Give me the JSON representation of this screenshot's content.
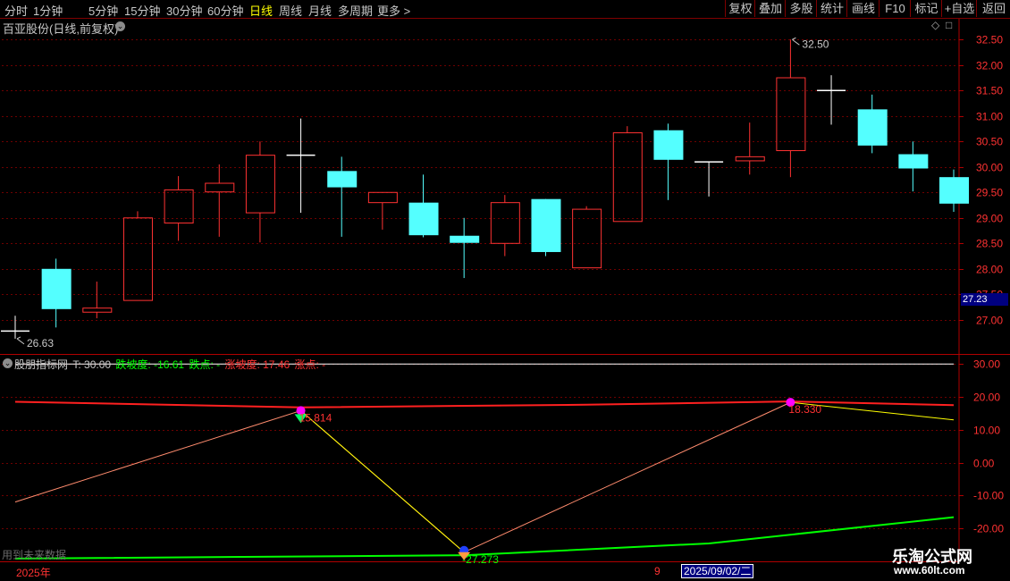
{
  "toolbar": {
    "periods": [
      "分时",
      "1分钟",
      "5分钟",
      "15分钟",
      "30分钟",
      "60分钟",
      "日线",
      "周线",
      "月线",
      "多周期",
      "更多 >"
    ],
    "active_period": "日线",
    "actions": [
      "复权",
      "叠加",
      "多股",
      "统计",
      "画线",
      "F10",
      "标记",
      "+自选",
      "返回"
    ]
  },
  "stock": {
    "title": "百亚股份(日线,前复权)"
  },
  "price_tag": "27.23",
  "indicator": {
    "name": "股朋指标网",
    "t_label": "T: 30.00",
    "down_slope": "跌坡度: -16.61",
    "down_point": "跌点: -",
    "up_slope": "涨坡度: 17.46",
    "up_point": "涨点: -",
    "colors": {
      "green": "#00ff00",
      "red": "#ff3232",
      "name": "#c8c8c8"
    }
  },
  "footer": {
    "future_note": "用到未来数据",
    "year_label": "2025年",
    "nine_label": "9",
    "date_label": "2025/09/02/二"
  },
  "watermark": {
    "line1": "乐淘公式网",
    "line2": "www.60lt.com"
  },
  "chart_data": [
    {
      "type": "candlestick",
      "ylim": [
        26.4,
        32.75
      ],
      "yticks": [
        27.0,
        27.5,
        28.0,
        28.5,
        29.0,
        29.5,
        30.0,
        30.5,
        31.0,
        31.5,
        32.0,
        32.5
      ],
      "tick_labels": [
        "27.00",
        "27.50",
        "28.00",
        "28.50",
        "29.00",
        "29.50",
        "30.00",
        "30.50",
        "31.00",
        "31.50",
        "32.00",
        "32.50"
      ],
      "grid": "horizontal dashed",
      "annotations": [
        {
          "text": "26.63",
          "index": 0,
          "value": 26.63
        },
        {
          "text": "32.50",
          "index": 19,
          "value": 32.5
        }
      ],
      "candles": [
        {
          "o": 26.78,
          "h": 27.08,
          "l": 26.63,
          "c": 26.78
        },
        {
          "o": 28.0,
          "h": 28.2,
          "l": 26.85,
          "c": 27.21
        },
        {
          "o": 27.15,
          "h": 27.75,
          "l": 27.03,
          "c": 27.23
        },
        {
          "o": 27.38,
          "h": 29.13,
          "l": 27.38,
          "c": 29.0
        },
        {
          "o": 28.9,
          "h": 29.82,
          "l": 28.55,
          "c": 29.55
        },
        {
          "o": 29.51,
          "h": 30.05,
          "l": 28.63,
          "c": 29.68
        },
        {
          "o": 29.1,
          "h": 30.5,
          "l": 28.52,
          "c": 30.23
        },
        {
          "o": 30.23,
          "h": 30.95,
          "l": 29.1,
          "c": 30.23
        },
        {
          "o": 29.92,
          "h": 30.2,
          "l": 28.63,
          "c": 29.6
        },
        {
          "o": 29.3,
          "h": 29.5,
          "l": 28.77,
          "c": 29.5
        },
        {
          "o": 29.3,
          "h": 29.85,
          "l": 28.62,
          "c": 28.66
        },
        {
          "o": 28.65,
          "h": 29.0,
          "l": 27.82,
          "c": 28.51
        },
        {
          "o": 28.5,
          "h": 29.45,
          "l": 28.25,
          "c": 29.3
        },
        {
          "o": 29.37,
          "h": 29.37,
          "l": 28.25,
          "c": 28.33
        },
        {
          "o": 28.02,
          "h": 29.23,
          "l": 28.02,
          "c": 29.17
        },
        {
          "o": 28.93,
          "h": 30.8,
          "l": 28.93,
          "c": 30.67
        },
        {
          "o": 30.72,
          "h": 30.85,
          "l": 29.35,
          "c": 30.14
        },
        {
          "o": 30.1,
          "h": 30.1,
          "l": 29.42,
          "c": 30.1
        },
        {
          "o": 30.12,
          "h": 30.87,
          "l": 29.85,
          "c": 30.2
        },
        {
          "o": 30.32,
          "h": 32.5,
          "l": 29.8,
          "c": 31.75
        },
        {
          "o": 31.5,
          "h": 31.8,
          "l": 30.83,
          "c": 31.5
        },
        {
          "o": 31.13,
          "h": 31.42,
          "l": 30.27,
          "c": 30.42
        },
        {
          "o": 30.25,
          "h": 30.5,
          "l": 29.52,
          "c": 29.97
        },
        {
          "o": 29.8,
          "h": 29.95,
          "l": 29.12,
          "c": 29.28
        }
      ]
    },
    {
      "type": "line",
      "ylim": [
        -29.5,
        32.5
      ],
      "yticks": [
        30,
        20,
        10,
        0,
        -10,
        -20
      ],
      "tick_labels": [
        "30.00",
        "20.00",
        "10.00",
        "0.00",
        "-10.00",
        "-20.00"
      ],
      "grid": "horizontal dashed",
      "series": [
        {
          "color": "#ffffff",
          "points": [
            [
              0,
              30
            ],
            [
              23,
              30
            ]
          ]
        },
        {
          "color": "#ff2020",
          "points": [
            [
              0,
              18.5
            ],
            [
              7,
              16.8
            ],
            [
              14,
              17.6
            ],
            [
              19,
              18.6
            ],
            [
              23,
              17.46
            ]
          ]
        },
        {
          "color": "#00ff00",
          "points": [
            [
              0,
              -29.2
            ],
            [
              11,
              -28.2
            ],
            [
              17,
              -24.6
            ],
            [
              23,
              -16.61
            ]
          ]
        },
        {
          "color": "#ff8c6e",
          "points": [
            [
              0,
              -12
            ],
            [
              7,
              15.81
            ],
            [
              11,
              -27.27
            ],
            [
              19,
              18.33
            ]
          ]
        },
        {
          "color": "#ffff00",
          "points": [
            [
              7,
              15.81
            ],
            [
              11,
              -27.27
            ]
          ]
        },
        {
          "color": "#ffff00",
          "points": [
            [
              19,
              18.33
            ],
            [
              23,
              13
            ]
          ]
        }
      ],
      "annotations": [
        {
          "text": "15.814",
          "index": 7,
          "value": 15.814
        },
        {
          "text": "-27.273",
          "index": 11,
          "value": -27.273
        },
        {
          "text": "18.330",
          "index": 19,
          "value": 18.33
        }
      ]
    }
  ]
}
